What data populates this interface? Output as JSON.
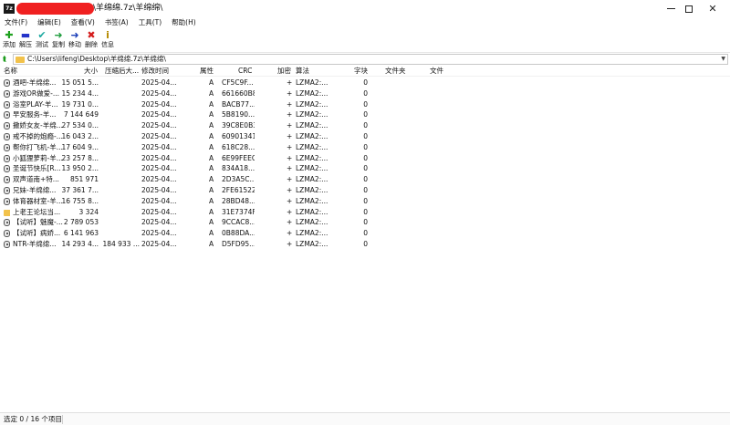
{
  "window": {
    "title": "\\羊绵绵.7z\\羊绵绵\\"
  },
  "menu": [
    "文件(F)",
    "编辑(E)",
    "查看(V)",
    "书签(A)",
    "工具(T)",
    "帮助(H)"
  ],
  "toolbar": [
    {
      "label": "添加",
      "icon": "plus-icon",
      "glyph": "✚",
      "color": "#1fa11f"
    },
    {
      "label": "解压",
      "icon": "minus-icon",
      "glyph": "▬",
      "color": "#2433c9"
    },
    {
      "label": "测试",
      "icon": "check-icon",
      "glyph": "✔",
      "color": "#1aa8a0"
    },
    {
      "label": "复制",
      "icon": "copy-arrow-icon",
      "glyph": "➜",
      "color": "#1e9c3c"
    },
    {
      "label": "移动",
      "icon": "move-arrow-icon",
      "glyph": "➜",
      "color": "#1b3fb8"
    },
    {
      "label": "删除",
      "icon": "delete-icon",
      "glyph": "✖",
      "color": "#d41c1c"
    },
    {
      "label": "信息",
      "icon": "info-icon",
      "glyph": "i",
      "color": "#b48a00"
    }
  ],
  "address": {
    "path": "C:\\Users\\lifeng\\Desktop\\羊绵绵.7z\\羊绵绵\\"
  },
  "columns": {
    "name": "名称",
    "size": "大小",
    "packed": "压缩后大...",
    "modified": "修改时间",
    "attributes": "属性",
    "crc": "CRC",
    "encrypted": "加密",
    "method": "算法",
    "characters": "字块",
    "folders": "文件夹",
    "files": "文件"
  },
  "files": [
    {
      "type": "file",
      "name": "酒吧-羊绵绵...",
      "size": "15 051 5...",
      "packed": "",
      "modified": "2025-04...",
      "attr": "A",
      "crc": "CF5C9F...",
      "enc": "+",
      "method": "LZMA2:...",
      "chars": "0"
    },
    {
      "type": "file",
      "name": "游戏OR做爱-...",
      "size": "15 234 4...",
      "packed": "",
      "modified": "2025-04...",
      "attr": "A",
      "crc": "661660B8",
      "enc": "+",
      "method": "LZMA2:...",
      "chars": "0"
    },
    {
      "type": "file",
      "name": "浴室PLAY-羊...",
      "size": "19 731 0...",
      "packed": "",
      "modified": "2025-04...",
      "attr": "A",
      "crc": "BACB77...",
      "enc": "+",
      "method": "LZMA2:...",
      "chars": "0"
    },
    {
      "type": "file",
      "name": "早安服务-羊...",
      "size": "7 144 649",
      "packed": "",
      "modified": "2025-04...",
      "attr": "A",
      "crc": "5B8190...",
      "enc": "+",
      "method": "LZMA2:...",
      "chars": "0"
    },
    {
      "type": "file",
      "name": "撒娇女友-羊绵...",
      "size": "27 534 0...",
      "packed": "",
      "modified": "2025-04...",
      "attr": "A",
      "crc": "39C8E0B3",
      "enc": "+",
      "method": "LZMA2:...",
      "chars": "0"
    },
    {
      "type": "file",
      "name": "戒不掉的炮瘾-...",
      "size": "16 043 2...",
      "packed": "",
      "modified": "2025-04...",
      "attr": "A",
      "crc": "60901341",
      "enc": "+",
      "method": "LZMA2:...",
      "chars": "0"
    },
    {
      "type": "file",
      "name": "帮你打飞机-羊...",
      "size": "17 604 9...",
      "packed": "",
      "modified": "2025-04...",
      "attr": "A",
      "crc": "618C28...",
      "enc": "+",
      "method": "LZMA2:...",
      "chars": "0"
    },
    {
      "type": "file",
      "name": "小狐狸萝莉-羊...",
      "size": "23 257 8...",
      "packed": "",
      "modified": "2025-04...",
      "attr": "A",
      "crc": "6E99FEEC",
      "enc": "+",
      "method": "LZMA2:...",
      "chars": "0"
    },
    {
      "type": "file",
      "name": "圣诞节快乐[R...",
      "size": "13 950 2...",
      "packed": "",
      "modified": "2025-04...",
      "attr": "A",
      "crc": "834A18...",
      "enc": "+",
      "method": "LZMA2:...",
      "chars": "0"
    },
    {
      "type": "file",
      "name": "双声道南+特...",
      "size": "851 971",
      "packed": "",
      "modified": "2025-04...",
      "attr": "A",
      "crc": "2D3A5C...",
      "enc": "+",
      "method": "LZMA2:...",
      "chars": "0"
    },
    {
      "type": "file",
      "name": "兄妹-羊绵绵...",
      "size": "37 361 7...",
      "packed": "",
      "modified": "2025-04...",
      "attr": "A",
      "crc": "2FE61522",
      "enc": "+",
      "method": "LZMA2:...",
      "chars": "0"
    },
    {
      "type": "file",
      "name": "体育器材室-羊...",
      "size": "16 755 8...",
      "packed": "",
      "modified": "2025-04...",
      "attr": "A",
      "crc": "28BD48...",
      "enc": "+",
      "method": "LZMA2:...",
      "chars": "0"
    },
    {
      "type": "folder",
      "name": "上老王论坛当...",
      "size": "3 324",
      "packed": "",
      "modified": "2025-04...",
      "attr": "A",
      "crc": "31E7374F",
      "enc": "+",
      "method": "LZMA2:...",
      "chars": "0"
    },
    {
      "type": "file",
      "name": "【试听】魅魔-...",
      "size": "2 789 053",
      "packed": "",
      "modified": "2025-04...",
      "attr": "A",
      "crc": "9CCAC8...",
      "enc": "+",
      "method": "LZMA2:...",
      "chars": "0"
    },
    {
      "type": "file",
      "name": "【试听】病娇...",
      "size": "6 141 963",
      "packed": "",
      "modified": "2025-04...",
      "attr": "A",
      "crc": "0B88DA...",
      "enc": "+",
      "method": "LZMA2:...",
      "chars": "0"
    },
    {
      "type": "file",
      "name": "NTR-羊绵绵...",
      "size": "14 293 4...",
      "packed": "184 933 ...",
      "modified": "2025-04...",
      "attr": "A",
      "crc": "D5FD95...",
      "enc": "+",
      "method": "LZMA2:...",
      "chars": "0"
    }
  ],
  "status": {
    "selection": "选定 0 / 16 个项目"
  }
}
